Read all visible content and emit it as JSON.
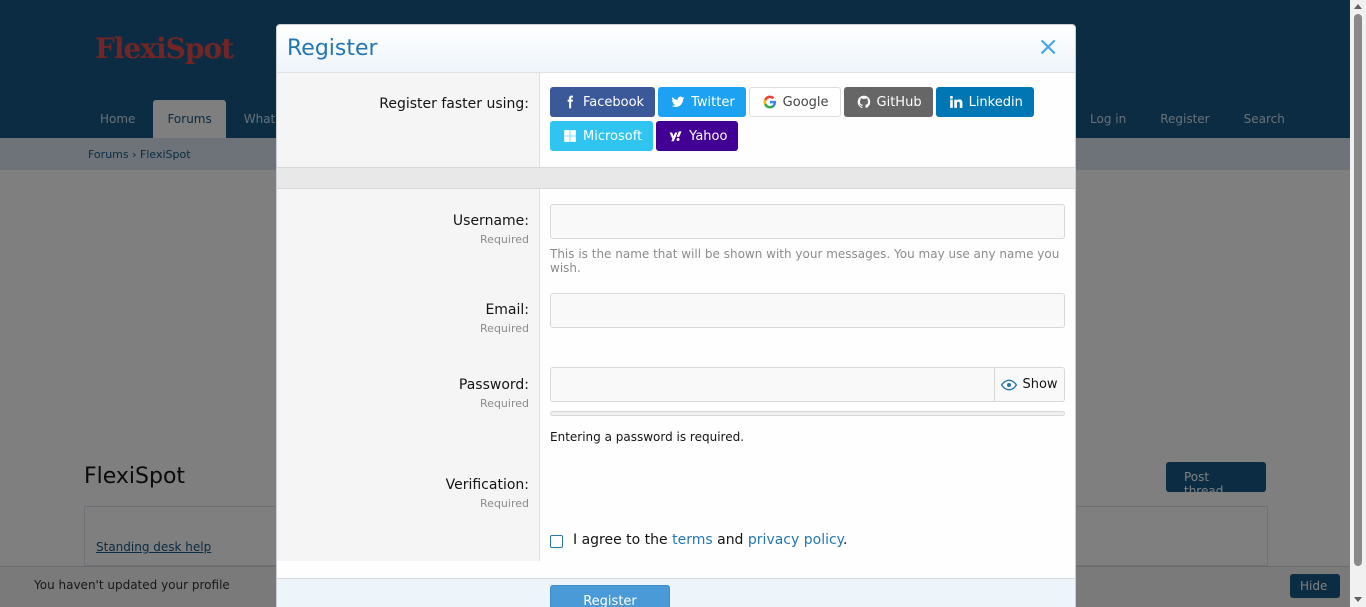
{
  "background": {
    "logo": "FlexiSpot",
    "nav_tabs": [
      "Home",
      "Forums",
      "What's new"
    ],
    "nav_right": [
      "Log in",
      "Register",
      "Search"
    ],
    "breadcrumb": "Forums  ›  FlexiSpot",
    "title": "FlexiSpot",
    "action_button": "Post thread",
    "link": "Standing desk help",
    "notice": "You haven't updated your profile",
    "notice_button": "Hide"
  },
  "modal": {
    "title": "Register",
    "close_glyph": "×",
    "social": {
      "label": "Register faster using:",
      "buttons": [
        {
          "label": "Facebook",
          "icon": "facebook-icon",
          "color": "#3b5998"
        },
        {
          "label": "Twitter",
          "icon": "twitter-icon",
          "color": "#1da1f3"
        },
        {
          "label": "Google",
          "icon": "google-icon",
          "color": "#ffffff"
        },
        {
          "label": "GitHub",
          "icon": "github-icon",
          "color": "#666666"
        },
        {
          "label": "Linkedin",
          "icon": "linkedin-icon",
          "color": "#0077b5"
        },
        {
          "label": "Microsoft",
          "icon": "microsoft-icon",
          "color": "#2fc5f0"
        },
        {
          "label": "Yahoo",
          "icon": "yahoo-icon",
          "color": "#410093"
        }
      ]
    },
    "username": {
      "label": "Username:",
      "required": "Required",
      "value": "",
      "hint": "This is the name that will be shown with your messages. You may use any name you wish."
    },
    "email": {
      "label": "Email:",
      "required": "Required",
      "value": ""
    },
    "password": {
      "label": "Password:",
      "required": "Required",
      "value": "",
      "show_label": "Show",
      "message": "Entering a password is required."
    },
    "verification": {
      "label": "Verification:",
      "required": "Required"
    },
    "agree": {
      "prefix": "I agree to the",
      "terms": "terms",
      "and": "and",
      "privacy": "privacy policy",
      "suffix": ".",
      "checked": false
    },
    "submit_label": "Register"
  },
  "colors": {
    "accent": "#2577b1",
    "header_bg": "#185886",
    "button": "#4a9ad8"
  }
}
